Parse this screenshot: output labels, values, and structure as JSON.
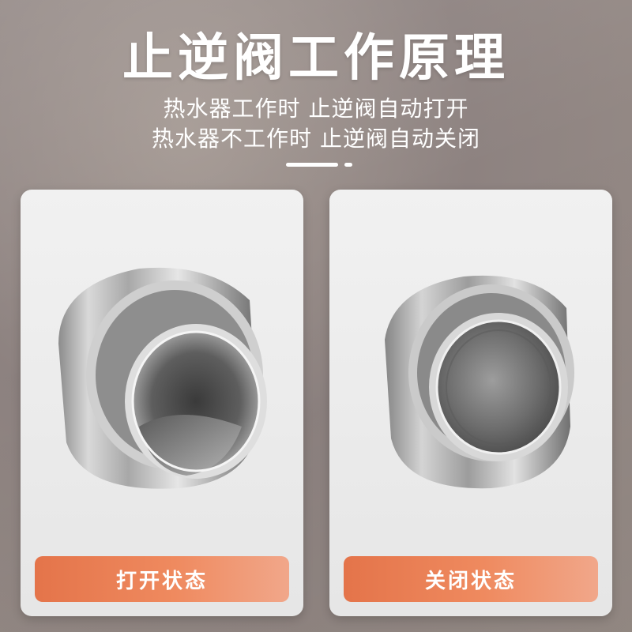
{
  "header": {
    "title": "止逆阀工作原理",
    "line1": "热水器工作时 止逆阀自动打开",
    "line2": "热水器不工作时 止逆阀自动关闭"
  },
  "cards": [
    {
      "label": "打开状态",
      "icon": "valve-open-icon"
    },
    {
      "label": "关闭状态",
      "icon": "valve-closed-icon"
    }
  ],
  "colors": {
    "button_start": "#e4744a",
    "button_end": "#f1a78a",
    "card": "#eeeeee",
    "background": "#958a86"
  }
}
